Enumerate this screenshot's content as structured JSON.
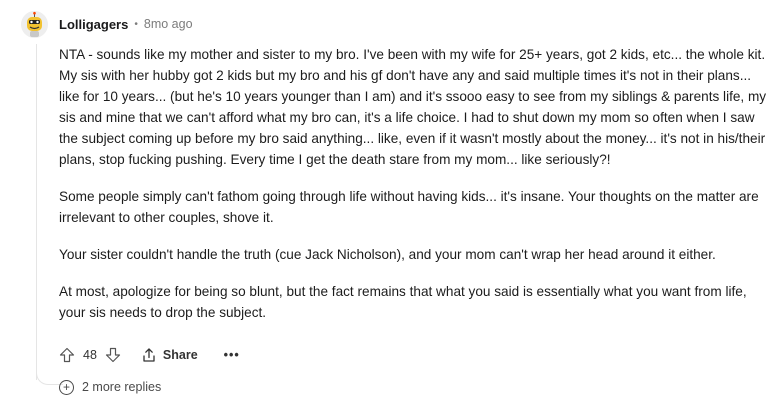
{
  "comment": {
    "author": "Lolligagers",
    "separator": "•",
    "timestamp": "8mo ago",
    "avatar_icon": "snoo-avatar-icon",
    "paragraphs": [
      "NTA - sounds like my mother and sister to my bro. I've been with my wife for 25+ years, got 2 kids, etc... the whole kit. My sis with her hubby got 2 kids but my bro and his gf don't have any and said multiple times it's not in their plans... like for 10 years... (but he's 10 years younger than I am) and it's ssooo easy to see from my siblings & parents life, my sis and mine that we can't afford what my bro can, it's a life choice. I had to shut down my mom so often when I saw the subject coming up before my bro said anything... like, even if it wasn't mostly about the money... it's not in his/their plans, stop fucking pushing. Every time I get the death stare from my mom... like seriously?!",
      "Some people simply can't fathom going through life without having kids... it's insane. Your thoughts on the matter are irrelevant to other couples, shove it.",
      "Your sister couldn't handle the truth (cue Jack Nicholson), and your mom can't wrap her head around it either.",
      "At most, apologize for being so blunt, but the fact remains that what you said is essentially what you want from life, your sis needs to drop the subject."
    ]
  },
  "actions": {
    "upvote_icon": "upvote-arrow-icon",
    "vote_count": "48",
    "downvote_icon": "downvote-arrow-icon",
    "share_icon": "share-icon",
    "share_label": "Share",
    "more_label": "•••"
  },
  "replies": {
    "icon": "plus-circle-icon",
    "label": "2 more replies"
  }
}
